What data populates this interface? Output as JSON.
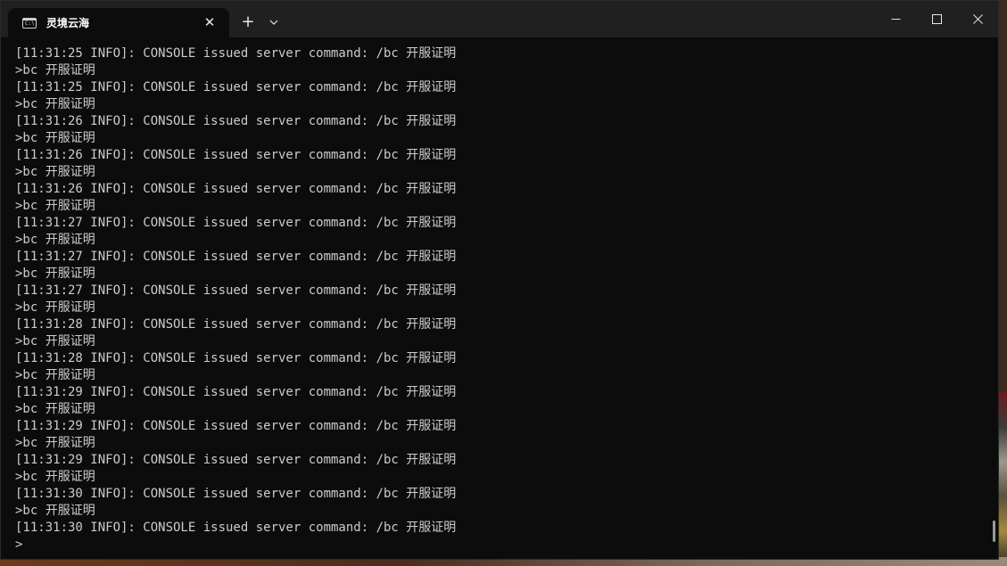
{
  "window": {
    "tab_title": "灵境云海",
    "tab_icon": "terminal-icon",
    "icon_text": "C:\\",
    "new_tab": "+",
    "close_tab": "✕"
  },
  "console": {
    "lines": [
      "[11:31:25 INFO]: CONSOLE issued server command: /bc 开服证明",
      ">bc 开服证明",
      "[11:31:25 INFO]: CONSOLE issued server command: /bc 开服证明",
      ">bc 开服证明",
      "[11:31:26 INFO]: CONSOLE issued server command: /bc 开服证明",
      ">bc 开服证明",
      "[11:31:26 INFO]: CONSOLE issued server command: /bc 开服证明",
      ">bc 开服证明",
      "[11:31:26 INFO]: CONSOLE issued server command: /bc 开服证明",
      ">bc 开服证明",
      "[11:31:27 INFO]: CONSOLE issued server command: /bc 开服证明",
      ">bc 开服证明",
      "[11:31:27 INFO]: CONSOLE issued server command: /bc 开服证明",
      ">bc 开服证明",
      "[11:31:27 INFO]: CONSOLE issued server command: /bc 开服证明",
      ">bc 开服证明",
      "[11:31:28 INFO]: CONSOLE issued server command: /bc 开服证明",
      ">bc 开服证明",
      "[11:31:28 INFO]: CONSOLE issued server command: /bc 开服证明",
      ">bc 开服证明",
      "[11:31:29 INFO]: CONSOLE issued server command: /bc 开服证明",
      ">bc 开服证明",
      "[11:31:29 INFO]: CONSOLE issued server command: /bc 开服证明",
      ">bc 开服证明",
      "[11:31:29 INFO]: CONSOLE issued server command: /bc 开服证明",
      ">bc 开服证明",
      "[11:31:30 INFO]: CONSOLE issued server command: /bc 开服证明",
      ">bc 开服证明",
      "[11:31:30 INFO]: CONSOLE issued server command: /bc 开服证明"
    ],
    "prompt": ">"
  },
  "colors": {
    "console_bg": "#0c0c0c",
    "console_text": "#cccccc",
    "titlebar_bg": "#202020"
  }
}
